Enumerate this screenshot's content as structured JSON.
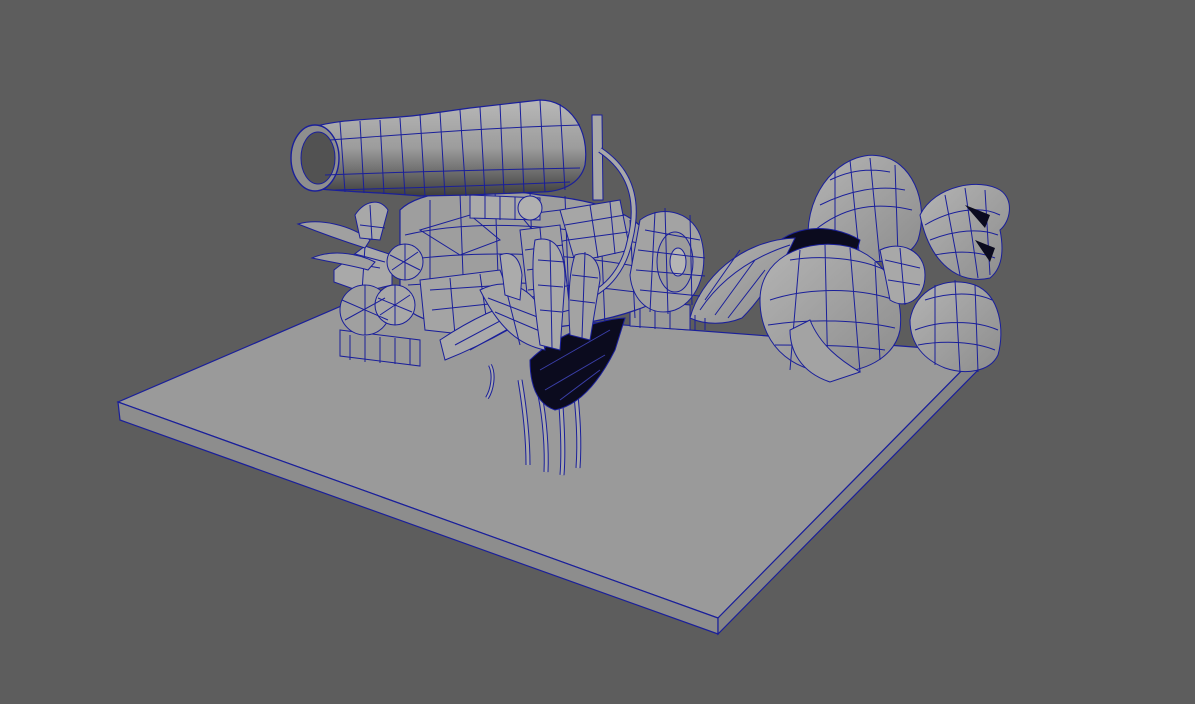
{
  "viewport": {
    "background_color": "#5d5d5d",
    "mesh_fill_color": "#9a9a9a",
    "mesh_side_color": "#8c8c8c",
    "wireframe_color": "#1a1f9a",
    "shadow_color": "#0b0b1e"
  },
  "scene": {
    "objects": [
      "ground-slab",
      "machine-body",
      "exhaust-pipe",
      "gear-wheel",
      "fern-plant",
      "leafy-bush"
    ]
  }
}
